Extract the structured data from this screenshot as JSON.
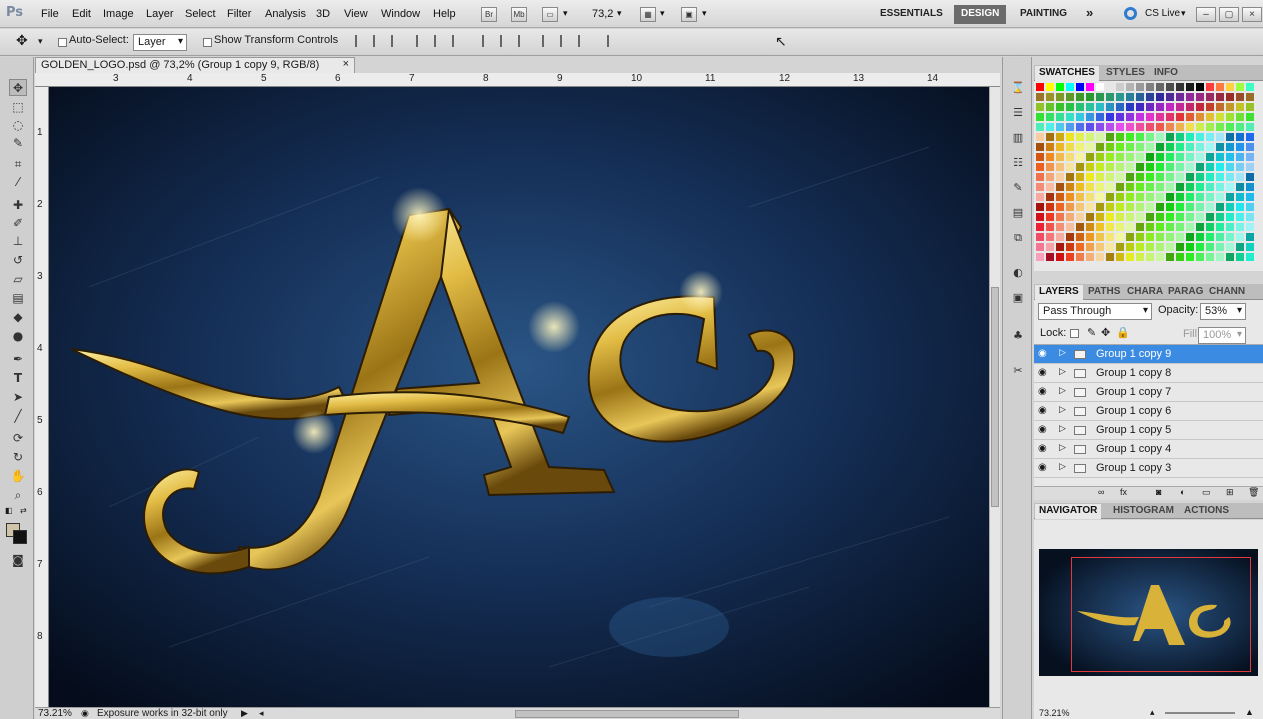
{
  "menubar": {
    "app_logo": "Ps",
    "items": [
      "File",
      "Edit",
      "Image",
      "Layer",
      "Select",
      "Filter",
      "Analysis",
      "3D",
      "View",
      "Window",
      "Help"
    ],
    "bridge_btn": "Br",
    "minibridge_btn": "Mb",
    "zoom_value": "73,2",
    "workspaces": [
      "ESSENTIALS",
      "DESIGN",
      "PAINTING"
    ],
    "more": "»",
    "cs_live": "CS Live"
  },
  "options": {
    "auto_select_label": "Auto-Select:",
    "auto_select_target": "Layer",
    "show_transform_label": "Show Transform Controls"
  },
  "document": {
    "tab_title": "GOLDEN_LOGO.psd @ 73,2% (Group 1 copy 9, RGB/8)",
    "close": "×",
    "ruler_top": [
      "3",
      "4",
      "5",
      "6",
      "7",
      "8",
      "9",
      "10",
      "11",
      "12",
      "13",
      "14"
    ],
    "ruler_left": [
      "1",
      "2",
      "3",
      "4",
      "5",
      "6",
      "7",
      "8"
    ],
    "artwork_text": "Ac",
    "status_zoom": "73.21%",
    "status_text": "Exposure works in 32-bit only"
  },
  "swatches_panel": {
    "tabs": [
      "SWATCHES",
      "STYLES",
      "INFO"
    ]
  },
  "layers_panel": {
    "tabs": [
      "LAYERS",
      "PATHS",
      "CHARA",
      "PARAG",
      "CHANN"
    ],
    "blend_mode": "Pass Through",
    "opacity_label": "Opacity:",
    "opacity_value": "53%",
    "lock_label": "Lock:",
    "fill_label": "Fill:",
    "fill_value": "100%",
    "layers": [
      {
        "name": "Group 1 copy 9",
        "selected": true
      },
      {
        "name": "Group 1 copy 8",
        "selected": false
      },
      {
        "name": "Group 1 copy 7",
        "selected": false
      },
      {
        "name": "Group 1 copy 6",
        "selected": false
      },
      {
        "name": "Group 1 copy 5",
        "selected": false
      },
      {
        "name": "Group 1 copy 4",
        "selected": false
      },
      {
        "name": "Group 1 copy 3",
        "selected": false
      }
    ]
  },
  "navigator_panel": {
    "tabs": [
      "NAVIGATOR",
      "HISTOGRAM",
      "ACTIONS"
    ],
    "zoom": "73.21%"
  },
  "colors": {
    "selection_blue": "#3b8be3",
    "gold": "#d9b23a",
    "background_blue": "#16315a",
    "view_box_red": "#e23a3a"
  }
}
